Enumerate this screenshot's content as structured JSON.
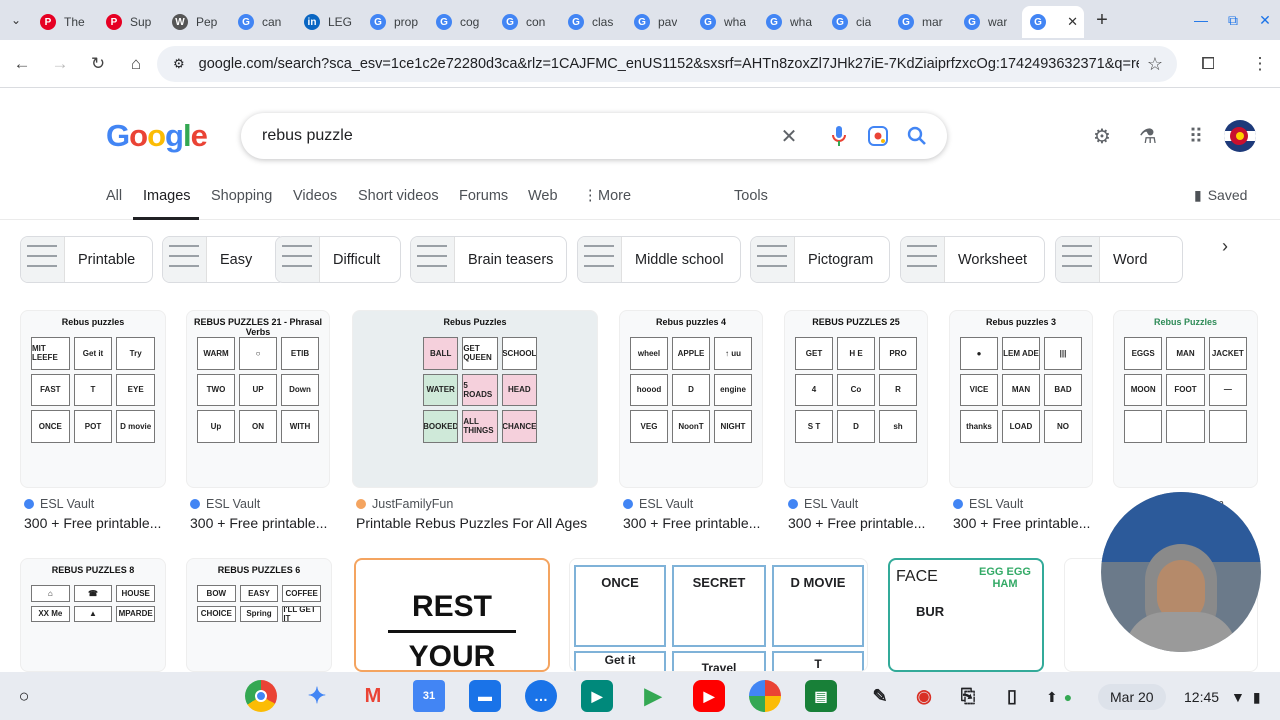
{
  "tabs": [
    {
      "label": "The",
      "fav": "P",
      "color": "#e60023"
    },
    {
      "label": "Sup",
      "fav": "P",
      "color": "#e60023"
    },
    {
      "label": "Pep",
      "fav": "W",
      "color": "#555555"
    },
    {
      "label": "can",
      "fav": "G",
      "color": "#4285f4"
    },
    {
      "label": "LEG",
      "fav": "in",
      "color": "#0a66c2"
    },
    {
      "label": "prop",
      "fav": "G",
      "color": "#4285f4"
    },
    {
      "label": "cog",
      "fav": "G",
      "color": "#4285f4"
    },
    {
      "label": "con",
      "fav": "G",
      "color": "#4285f4"
    },
    {
      "label": "clas",
      "fav": "G",
      "color": "#4285f4"
    },
    {
      "label": "pav",
      "fav": "G",
      "color": "#4285f4"
    },
    {
      "label": "wha",
      "fav": "G",
      "color": "#4285f4"
    },
    {
      "label": "wha",
      "fav": "G",
      "color": "#4285f4"
    },
    {
      "label": "cia",
      "fav": "G",
      "color": "#4285f4"
    },
    {
      "label": "mar",
      "fav": "G",
      "color": "#4285f4"
    },
    {
      "label": "war",
      "fav": "G",
      "color": "#4285f4"
    }
  ],
  "address": {
    "url": "google.com/search?sca_esv=1ce1c2e72280d3ca&rlz=1CAJFMC_enUS1152&sxsrf=AHTn8zoxZl7JHk27iE-7KdZiaiprfzxcOg:1742493632371&q=rebus..."
  },
  "search": {
    "query": "rebus puzzle"
  },
  "nav": {
    "all": "All",
    "images": "Images",
    "shopping": "Shopping",
    "videos": "Videos",
    "short_videos": "Short videos",
    "forums": "Forums",
    "web": "Web",
    "more": "More",
    "tools": "Tools",
    "saved": "Saved"
  },
  "chips": [
    "Printable",
    "Easy",
    "Difficult",
    "Brain teasers",
    "Middle school",
    "Pictogram",
    "Worksheet",
    "Word"
  ],
  "results_row1": [
    {
      "title": "Rebus puzzles",
      "source": "ESL Vault",
      "caption": "300 + Free printable..."
    },
    {
      "title": "REBUS PUZZLES 21 - Phrasal Verbs",
      "source": "ESL Vault",
      "caption": "300 + Free printable..."
    },
    {
      "title": "Rebus Puzzles",
      "source": "JustFamilyFun",
      "caption": "Printable Rebus Puzzles For All Ages"
    },
    {
      "title": "Rebus puzzles 4",
      "source": "ESL Vault",
      "caption": "300 + Free printable..."
    },
    {
      "title": "REBUS PUZZLES 25",
      "source": "ESL Vault",
      "caption": "300 + Free printable..."
    },
    {
      "title": "Rebus puzzles 3",
      "source": "ESL Vault",
      "caption": "300 + Free printable..."
    },
    {
      "title": "Rebus Puzzles",
      "source": "...com",
      "caption": ""
    }
  ],
  "results_row2": [
    {
      "title": "REBUS PUZZLES 8"
    },
    {
      "title": "REBUS PUZZLES 6"
    },
    {
      "line1": "REST",
      "line2": "YOUR"
    },
    {
      "c1": "ONCE",
      "c2": "SECRET",
      "c3": "D MOVIE",
      "c4": "Get it",
      "c5": "Travel",
      "c6": "T"
    },
    {
      "c1": "FACE",
      "c2": "EGG EGG HAM",
      "c3": "BUR"
    },
    {
      "title": ""
    }
  ],
  "taskbar": {
    "date": "Mar 20",
    "time": "12:45"
  }
}
